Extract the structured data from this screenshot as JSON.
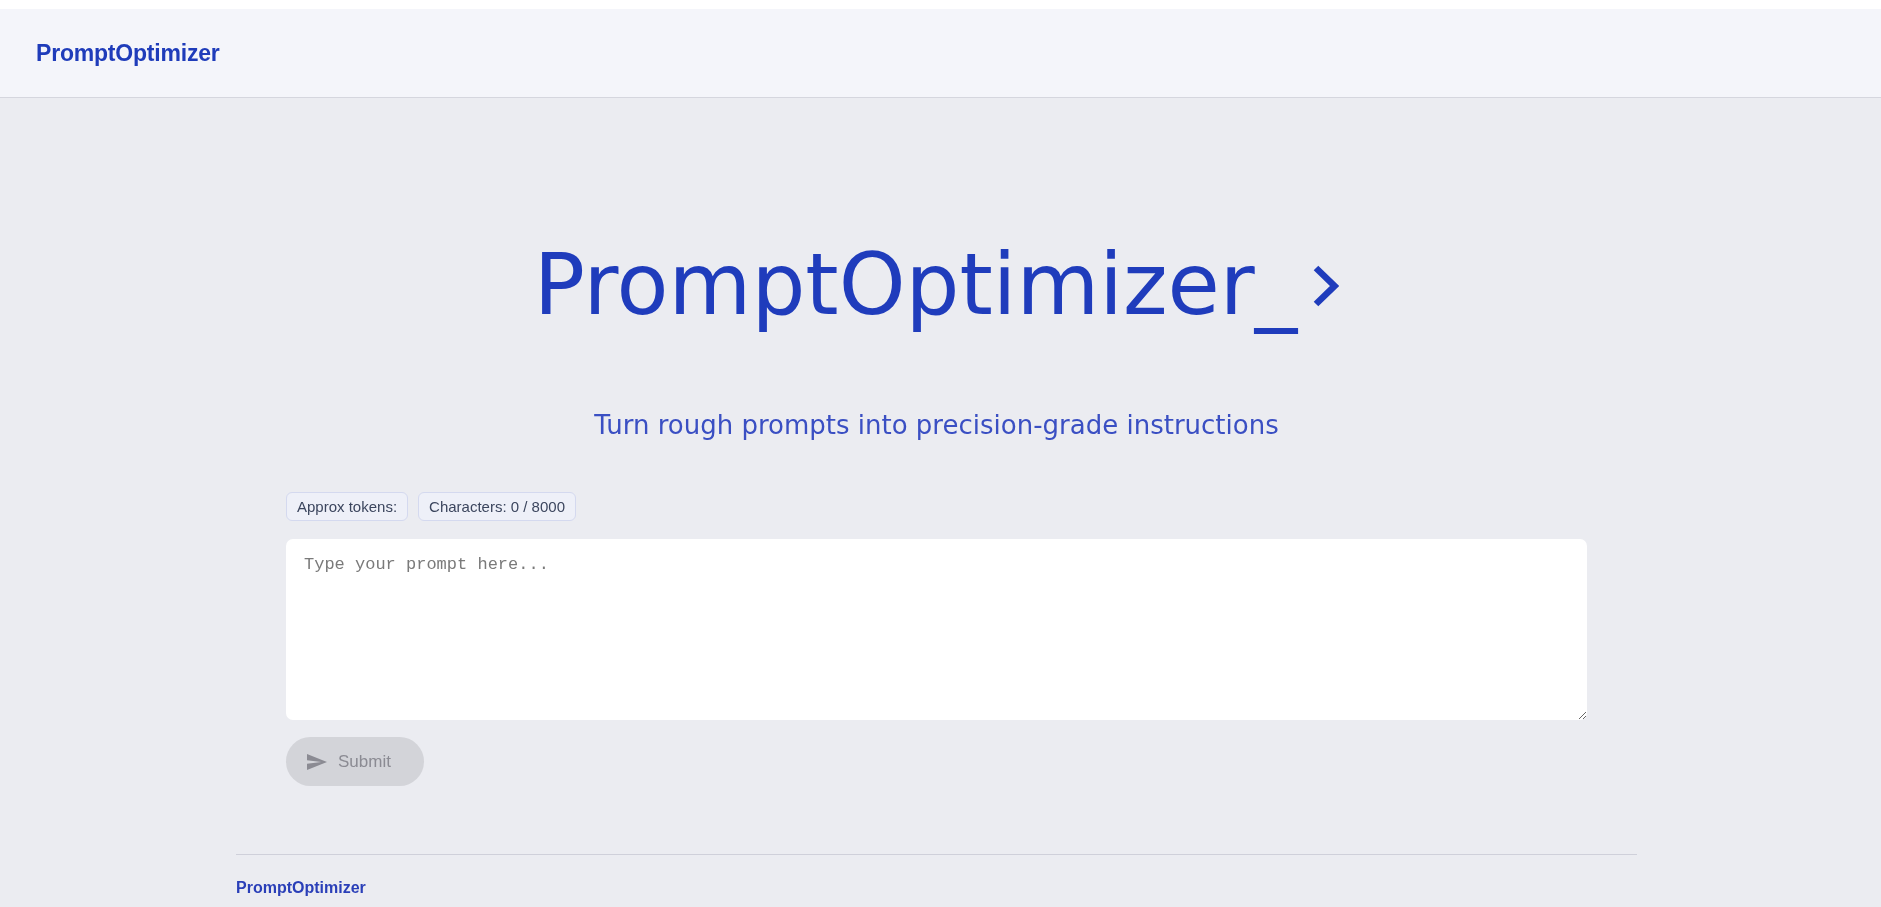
{
  "header": {
    "logo": "PromptOptimizer"
  },
  "hero": {
    "title": "PromptOptimizer_",
    "subtitle": "Turn rough prompts into precision-grade instructions"
  },
  "stats": [
    "Approx tokens:",
    "Characters: 0 / 8000"
  ],
  "prompt": {
    "placeholder": "Type your prompt here..."
  },
  "submit": {
    "label": "Submit",
    "disabled": true
  },
  "footer": {
    "brand": "PromptOptimizer"
  }
}
